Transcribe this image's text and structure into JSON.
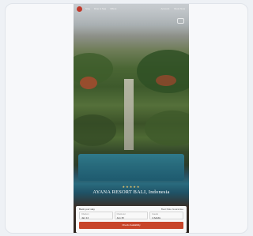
{
  "header": {
    "nav": [
      "Stay",
      "Dine & Spa",
      "Offers"
    ],
    "right": [
      "Account",
      "Book Now"
    ]
  },
  "hero": {
    "rating": "★★★★★",
    "title": "AYANA RESORT BALI, Indonesia"
  },
  "booking": {
    "title": "Book your stay",
    "link": "Best Rate Guarantee",
    "fields": [
      {
        "label": "Check-in",
        "value": "Jan 14"
      },
      {
        "label": "Check-out",
        "value": "Jan 15"
      },
      {
        "label": "Guests",
        "value": "2 Adults"
      }
    ],
    "cta": "Check Availability"
  },
  "colors": {
    "accent": "#c8452a",
    "logo": "#c0392b"
  }
}
